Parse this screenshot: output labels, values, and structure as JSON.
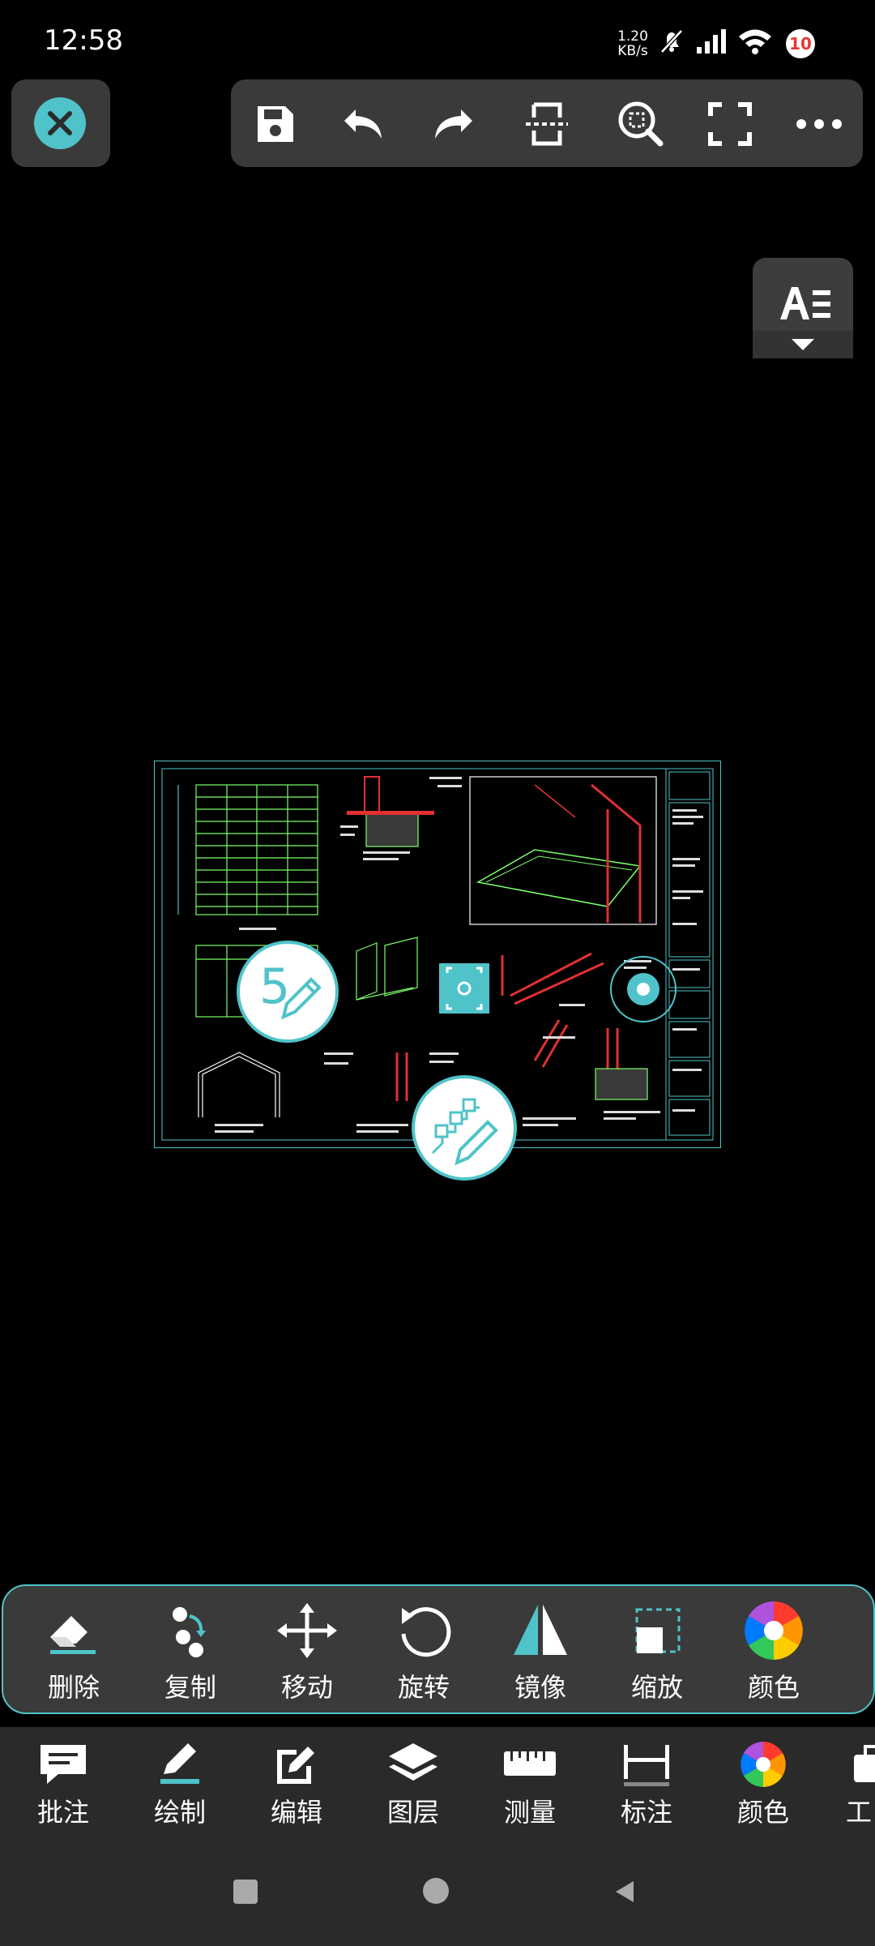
{
  "status_bar": {
    "time": "12:58",
    "speed_value": "1.20",
    "speed_unit": "KB/s",
    "notification_count": "10"
  },
  "top_toolbar": {
    "buttons": [
      "save-icon",
      "undo-icon",
      "redo-icon",
      "split-view-icon",
      "zoom-area-icon",
      "fullscreen-icon",
      "more-icon"
    ]
  },
  "edit_toolbar": {
    "items": [
      {
        "label": "删除",
        "icon": "eraser-icon"
      },
      {
        "label": "复制",
        "icon": "copy-icon"
      },
      {
        "label": "移动",
        "icon": "move-icon"
      },
      {
        "label": "旋转",
        "icon": "rotate-icon"
      },
      {
        "label": "镜像",
        "icon": "mirror-icon"
      },
      {
        "label": "缩放",
        "icon": "scale-icon"
      },
      {
        "label": "颜色",
        "icon": "color-wheel-icon"
      }
    ]
  },
  "bottom_nav": {
    "items": [
      {
        "label": "批注",
        "icon": "comment-icon"
      },
      {
        "label": "绘制",
        "icon": "draw-icon"
      },
      {
        "label": "编辑",
        "icon": "edit-icon"
      },
      {
        "label": "图层",
        "icon": "layers-icon"
      },
      {
        "label": "测量",
        "icon": "ruler-icon"
      },
      {
        "label": "标注",
        "icon": "dimension-icon"
      },
      {
        "label": "颜色",
        "icon": "color-wheel-icon"
      },
      {
        "label": "工",
        "icon": "toolbox-icon"
      }
    ]
  },
  "drawing": {
    "floating_badge_number": "5",
    "colors": {
      "cyan": "#4fc3c9",
      "red": "#e03030",
      "green": "#7cff6a",
      "white": "#ffffff"
    }
  },
  "colors": {
    "accent": "#4fc3c9",
    "panel": "#3a3a3a",
    "background": "#000000"
  }
}
